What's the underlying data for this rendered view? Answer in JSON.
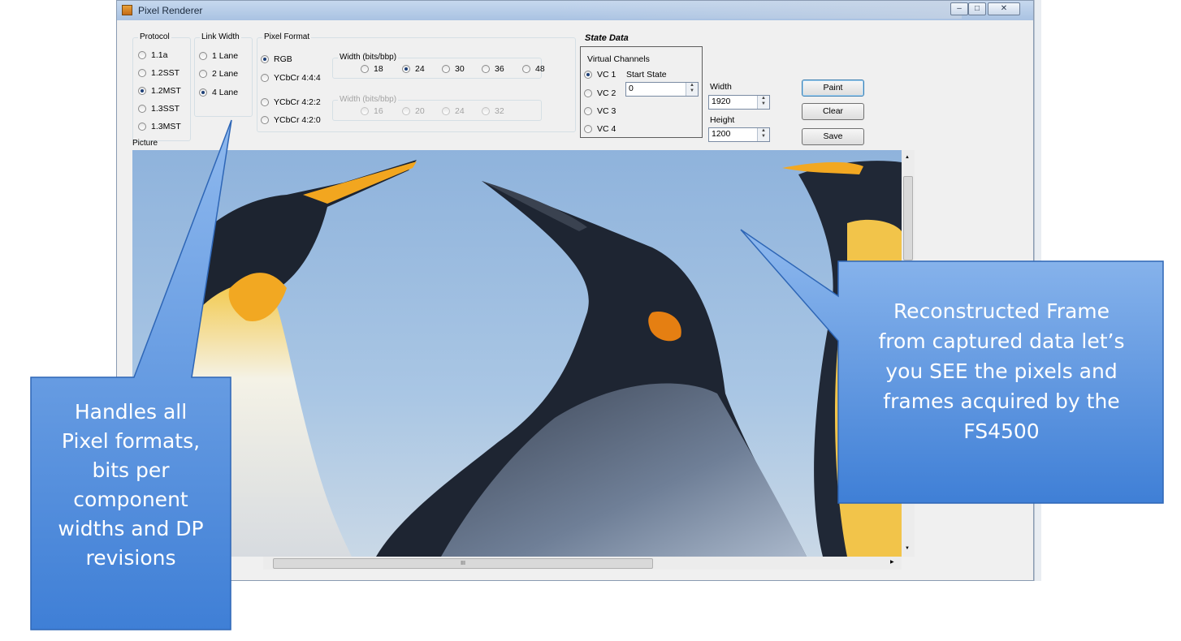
{
  "window": {
    "title": "Pixel Renderer",
    "controls": [
      "–",
      "□",
      "✕"
    ]
  },
  "protocol": {
    "label": "Protocol",
    "options": [
      {
        "label": "1.1a",
        "selected": false
      },
      {
        "label": "1.2SST",
        "selected": false
      },
      {
        "label": "1.2MST",
        "selected": true
      },
      {
        "label": "1.3SST",
        "selected": false
      },
      {
        "label": "1.3MST",
        "selected": false
      }
    ]
  },
  "link_width": {
    "label": "Link Width",
    "options": [
      {
        "label": "1 Lane",
        "selected": false
      },
      {
        "label": "2 Lane",
        "selected": false
      },
      {
        "label": "4 Lane",
        "selected": true
      }
    ]
  },
  "pixel_format": {
    "label": "Pixel Format",
    "options": [
      {
        "label": "RGB",
        "selected": true
      },
      {
        "label": "YCbCr 4:4:4",
        "selected": false
      },
      {
        "label": "YCbCr 4:2:2",
        "selected": false
      },
      {
        "label": "YCbCr 4:2:0",
        "selected": false
      }
    ],
    "width_rgb": {
      "label": "Width (bits/bbp)",
      "options": [
        {
          "label": "18",
          "selected": false
        },
        {
          "label": "24",
          "selected": true
        },
        {
          "label": "30",
          "selected": false
        },
        {
          "label": "36",
          "selected": false
        },
        {
          "label": "48",
          "selected": false
        }
      ]
    },
    "width_ycbcr": {
      "label": "Width (bits/bbp)",
      "options": [
        {
          "label": "16",
          "selected": false
        },
        {
          "label": "20",
          "selected": false
        },
        {
          "label": "24",
          "selected": false
        },
        {
          "label": "32",
          "selected": false
        }
      ]
    }
  },
  "state_data": {
    "title": "State Data",
    "virtual_channels_label": "Virtual Channels",
    "channels": [
      {
        "label": "VC 1",
        "selected": true
      },
      {
        "label": "VC 2",
        "selected": false
      },
      {
        "label": "VC 3",
        "selected": false
      },
      {
        "label": "VC 4",
        "selected": false
      }
    ],
    "start_state_label": "Start State",
    "start_state_value": "0"
  },
  "dimensions": {
    "width_label": "Width",
    "width_value": "1920",
    "height_label": "Height",
    "height_value": "1200"
  },
  "buttons": {
    "paint": "Paint",
    "clear": "Clear",
    "save": "Save"
  },
  "picture_label": "Picture",
  "scrollbar_grip": "III",
  "callouts": {
    "left": [
      "Handles all",
      "Pixel formats,",
      "bits per",
      "component",
      "widths  and DP",
      "revisions"
    ],
    "right": [
      "Reconstructed Frame",
      "from captured data let’s",
      "you SEE the pixels and",
      "frames acquired by the",
      "FS4500"
    ]
  },
  "colors": {
    "callout_top": "#8fb9ee",
    "callout_bottom": "#3f7fd6",
    "sky": "#9ebfe0",
    "window_bg": "#f0f0f0"
  }
}
